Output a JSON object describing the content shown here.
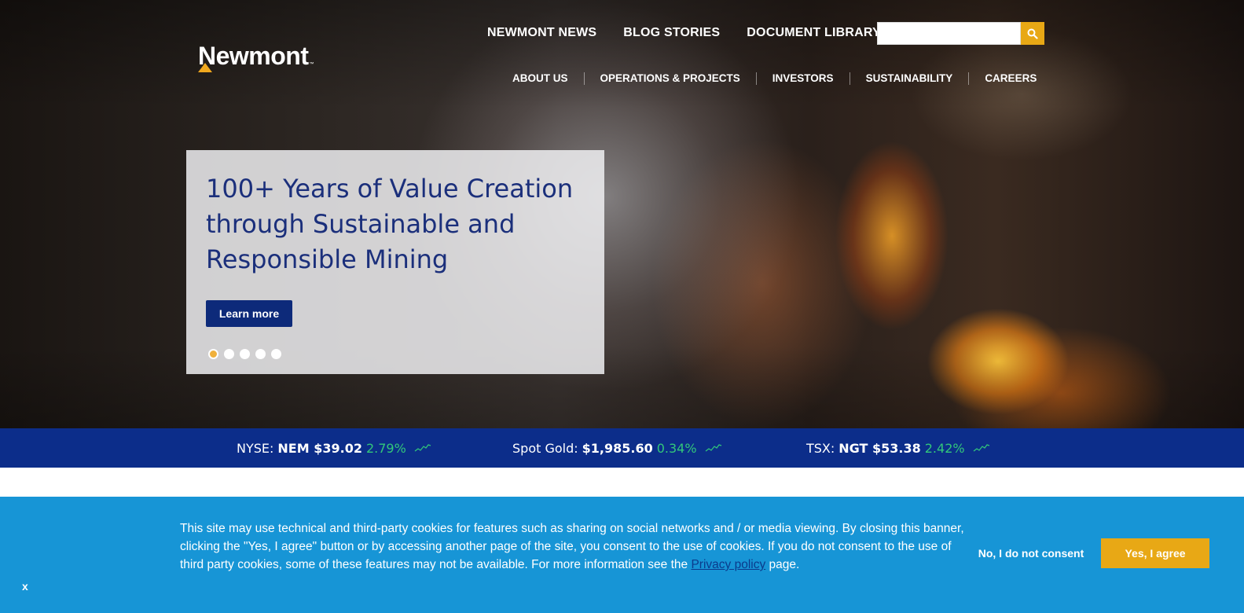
{
  "header": {
    "logo_text": "Newmont",
    "logo_tm": "™",
    "top_links": [
      "NEWMONT NEWS",
      "BLOG STORIES",
      "DOCUMENT LIBRARY"
    ],
    "search": {
      "placeholder": "",
      "value": "",
      "icon": "search-icon"
    },
    "main_nav": [
      "ABOUT US",
      "OPERATIONS & PROJECTS",
      "INVESTORS",
      "SUSTAINABILITY",
      "CAREERS"
    ]
  },
  "hero": {
    "title": "100+ Years of Value Creation through Sustainable and Responsible Mining",
    "button_label": "Learn more",
    "slides_count": 5,
    "active_slide": 1
  },
  "ticker": [
    {
      "exchange": "NYSE:",
      "symbol": "NEM $39.02",
      "change": "2.79%"
    },
    {
      "exchange": "Spot Gold:",
      "symbol": "$1,985.60",
      "change": "0.34%"
    },
    {
      "exchange": "TSX:",
      "symbol": "NGT $53.38",
      "change": "2.42%"
    }
  ],
  "cookie": {
    "text_before_link": "This site may use technical and third-party cookies for features such as sharing on social networks and / or media viewing. By closing this banner, clicking the \"Yes, I agree\" button or by accessing another page of the site, you consent to the use of cookies. If you do not consent to the use of third party cookies, some of these features may not be available. For more information see the ",
    "link_text": "Privacy policy",
    "text_after_link": " page.",
    "decline_label": "No, I do not consent",
    "accept_label": "Yes, I agree",
    "close_label": "x"
  },
  "colors": {
    "navy": "#0c2d8a",
    "gold": "#e8a815",
    "cookie_blue": "#1795d6",
    "positive_green": "#32c77a"
  }
}
